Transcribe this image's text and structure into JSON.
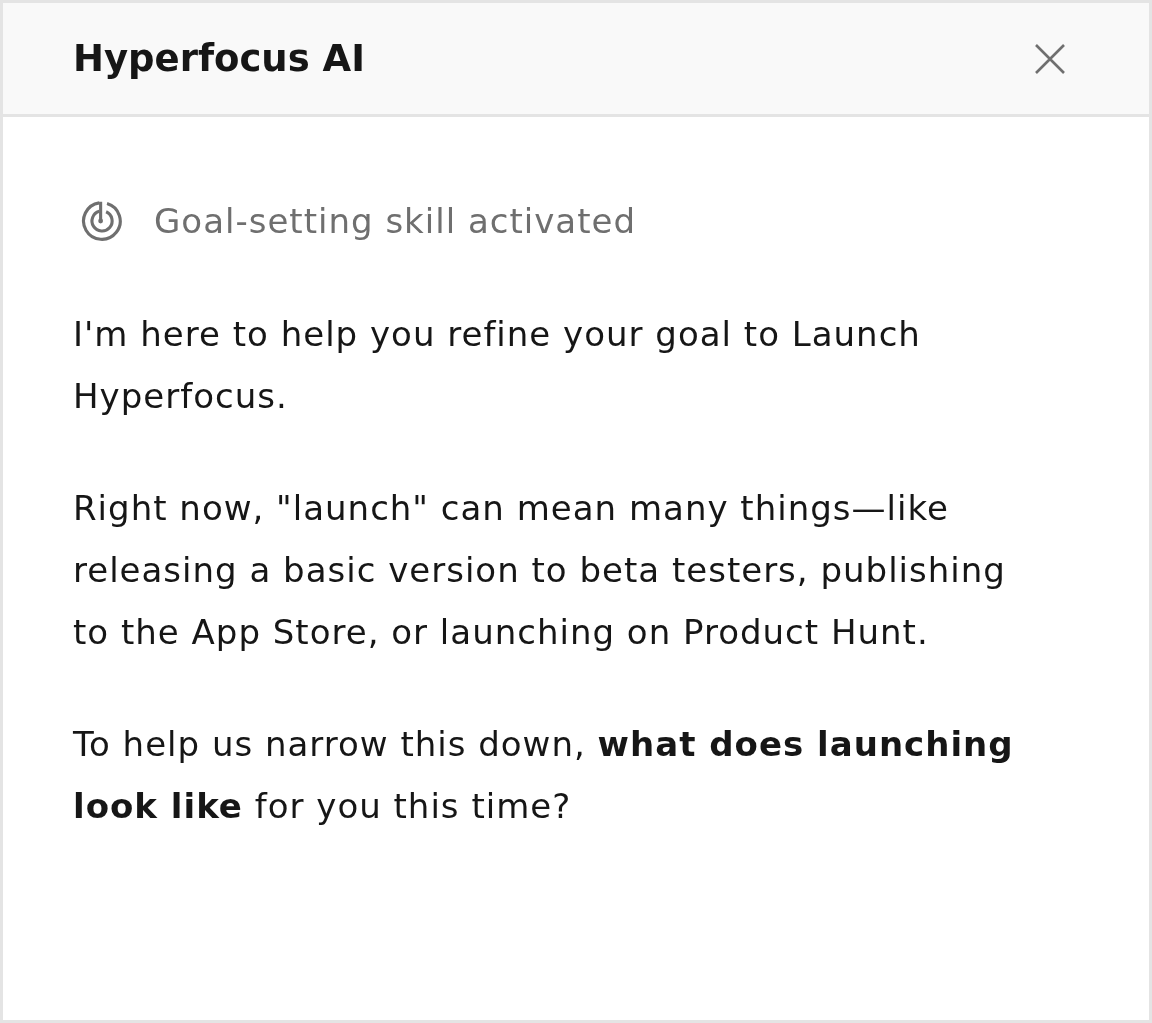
{
  "header": {
    "title": "Hyperfocus AI"
  },
  "status": {
    "text": "Goal-setting skill activated"
  },
  "message": {
    "paragraphs": [
      "I'm here to help you refine your goal to Launch Hyperfocus.",
      "Right now, \"launch\" can mean many things—like releasing a basic version to beta testers, publishing to the App Store, or launching on Product Hunt.",
      "To help us narrow this down, **what does launching look like** for you this time?"
    ]
  }
}
